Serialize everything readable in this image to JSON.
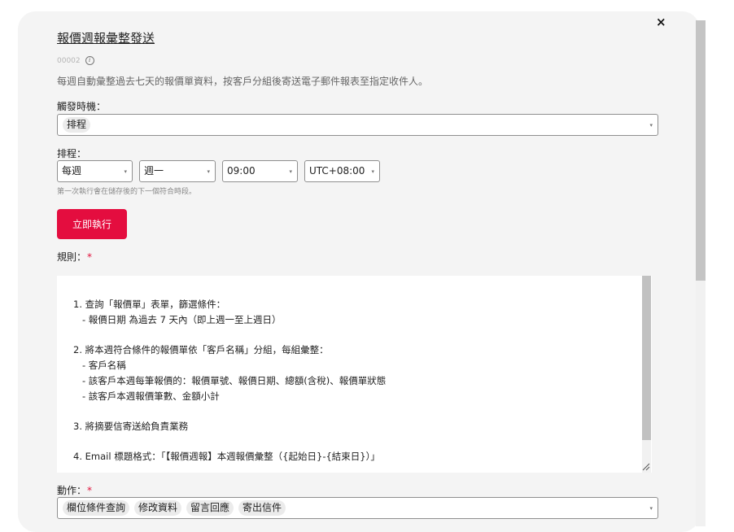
{
  "dialog": {
    "title": "報價週報彙整發送",
    "id": "00002",
    "description": "每週自動彙整過去七天的報價單資料，按客戶分組後寄送電子郵件報表至指定收件人。",
    "close_icon": "×"
  },
  "trigger": {
    "label": "觸發時機：",
    "tags": [
      "排程"
    ]
  },
  "schedule": {
    "label": "排程：",
    "frequency": "每週",
    "weekday": "週一",
    "time": "09:00",
    "timezone": "UTC+08:00",
    "hint": "第一次執行會在儲存後的下一個符合時段。"
  },
  "run_now_label": "立即執行",
  "rules": {
    "label": "規則：",
    "required_mark": "*",
    "lines": [
      "1. 查詢「報價單」表單，篩選條件：",
      "   - 報價日期 為過去 7 天內（即上週一至上週日）",
      "",
      "2. 將本週符合條件的報價單依「客戶名稱」分組，每組彙整：",
      "   - 客戶名稱",
      "   - 該客戶本週每筆報價的：報價單號、報價日期、總額(含稅)、報價單狀態",
      "   - 該客戶本週報價筆數、金額小計",
      "",
      "3. 將摘要信寄送給負責業務",
      "",
      "4. Email 標題格式：「【報價週報】本週報價彙整（{起始日}-{結束日}）」"
    ]
  },
  "actions": {
    "label": "動作：",
    "required_mark": "*",
    "tags": [
      "欄位條件查詢",
      "修改資料",
      "留言回應",
      "寄出信件"
    ]
  },
  "icons": {
    "caret": "▾",
    "info": "i"
  }
}
